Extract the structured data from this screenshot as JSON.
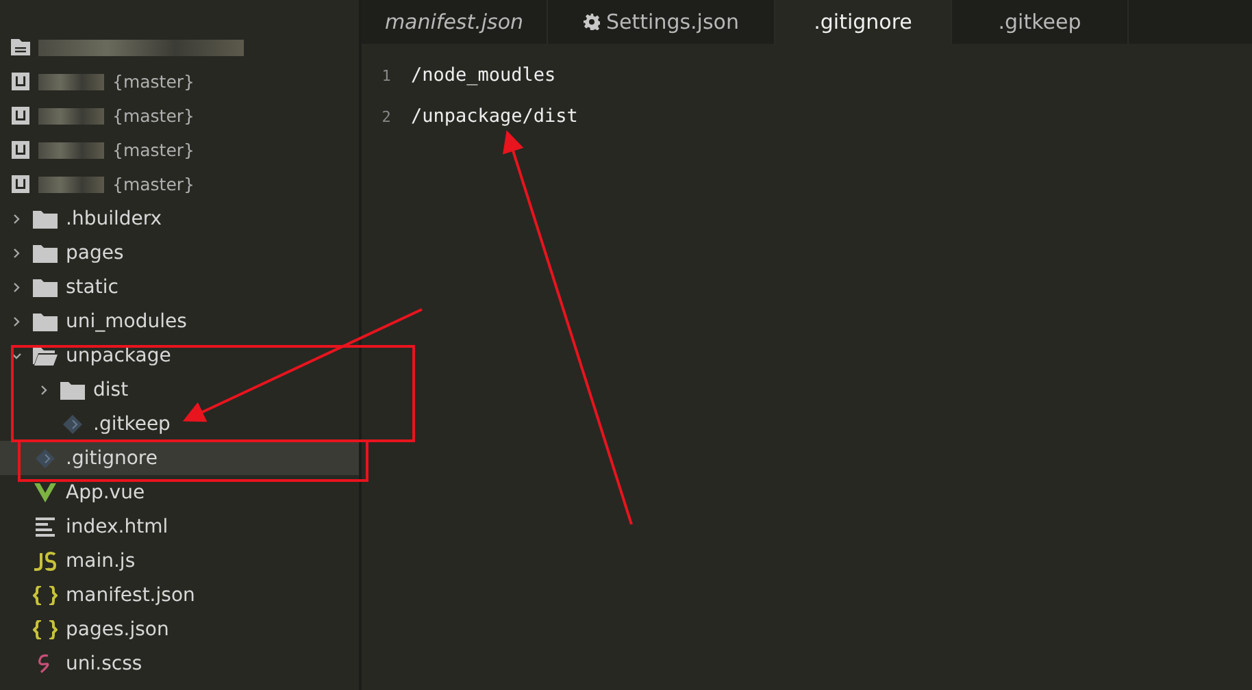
{
  "projects": [
    {
      "kind": "workspace"
    },
    {
      "kind": "git",
      "branch": "{master}"
    },
    {
      "kind": "git",
      "branch": "{master}"
    },
    {
      "kind": "git",
      "branch": "{master}"
    },
    {
      "kind": "git",
      "branch": "{master}"
    }
  ],
  "tree": [
    {
      "name": ".hbuilderx",
      "kind": "folder",
      "expanded": false,
      "selected": false
    },
    {
      "name": "pages",
      "kind": "folder",
      "expanded": false,
      "selected": false
    },
    {
      "name": "static",
      "kind": "folder",
      "expanded": false,
      "selected": false
    },
    {
      "name": "uni_modules",
      "kind": "folder",
      "expanded": false,
      "selected": false
    },
    {
      "name": "unpackage",
      "kind": "folder",
      "expanded": true,
      "selected": false,
      "children": [
        {
          "name": "dist",
          "kind": "folder",
          "expanded": false,
          "selected": false
        },
        {
          "name": ".gitkeep",
          "kind": "git",
          "selected": false
        }
      ]
    },
    {
      "name": ".gitignore",
      "kind": "git",
      "selected": true
    },
    {
      "name": "App.vue",
      "kind": "vue",
      "selected": false
    },
    {
      "name": "index.html",
      "kind": "html",
      "selected": false
    },
    {
      "name": "main.js",
      "kind": "js",
      "selected": false
    },
    {
      "name": "manifest.json",
      "kind": "json",
      "selected": false
    },
    {
      "name": "pages.json",
      "kind": "json",
      "selected": false
    },
    {
      "name": "uni.scss",
      "kind": "scss",
      "selected": false
    }
  ],
  "tabs": [
    {
      "label": "manifest.json",
      "selected": false,
      "preview": true,
      "settings": false
    },
    {
      "label": "Settings.json",
      "selected": false,
      "preview": false,
      "settings": true
    },
    {
      "label": ".gitignore",
      "selected": true,
      "preview": false,
      "settings": false
    },
    {
      "label": ".gitkeep",
      "selected": false,
      "preview": false,
      "settings": false
    }
  ],
  "editor": {
    "lines": [
      {
        "number": "1",
        "text": "/node_moudles"
      },
      {
        "number": "2",
        "text": "/unpackage/dist"
      }
    ]
  }
}
